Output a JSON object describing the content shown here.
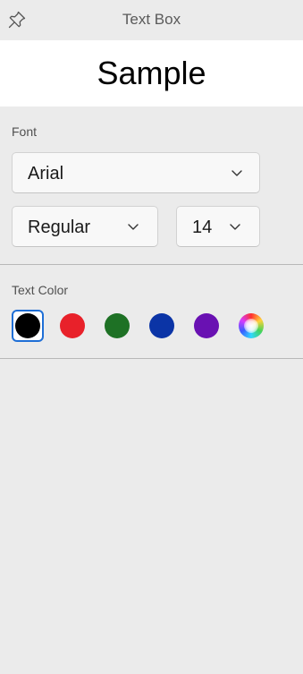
{
  "panel": {
    "title": "Text Box",
    "pin_icon": "pin-icon"
  },
  "preview": {
    "text": "Sample"
  },
  "font_section": {
    "label": "Font",
    "family": "Arial",
    "style": "Regular",
    "size": "14"
  },
  "color_section": {
    "label": "Text Color",
    "swatches": [
      {
        "name": "black",
        "color": "#000000",
        "selected": true
      },
      {
        "name": "red",
        "color": "#e8212a",
        "selected": false
      },
      {
        "name": "green",
        "color": "#1e7125",
        "selected": false
      },
      {
        "name": "blue",
        "color": "#0b34a6",
        "selected": false
      },
      {
        "name": "purple",
        "color": "#6911b2",
        "selected": false
      },
      {
        "name": "custom-color-picker",
        "color": "conic-gradient",
        "selected": false
      }
    ]
  }
}
